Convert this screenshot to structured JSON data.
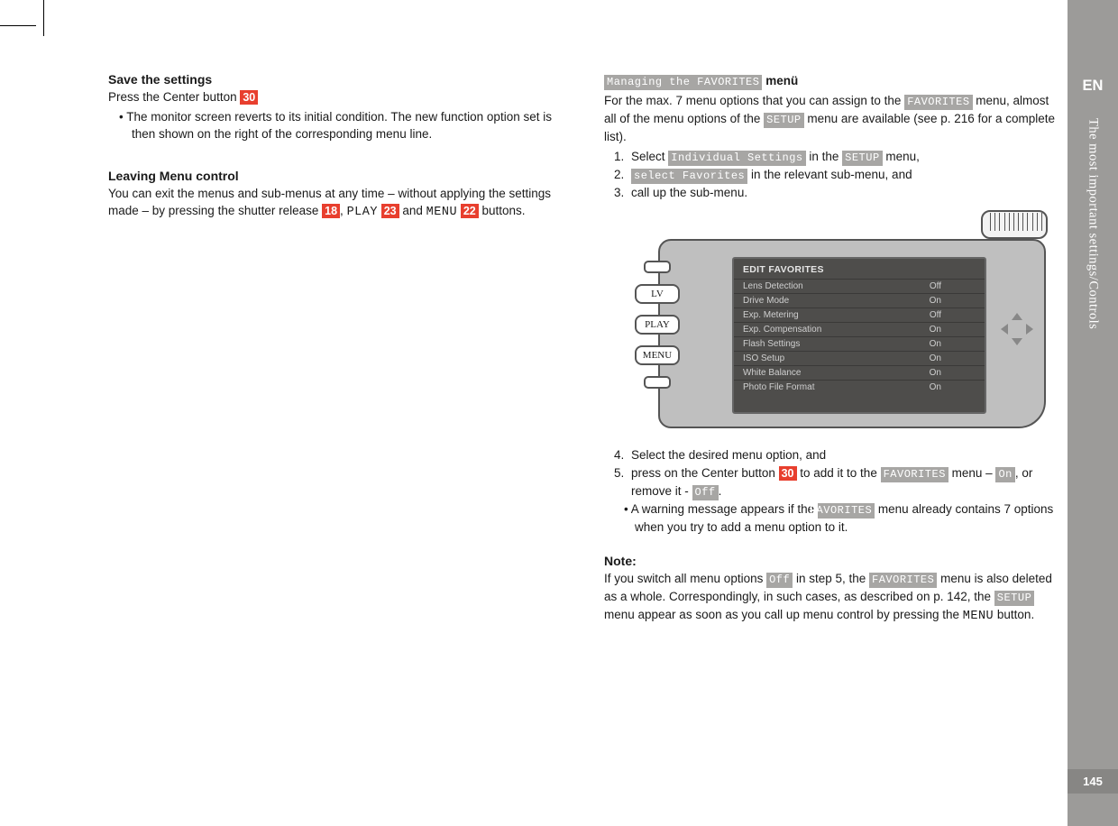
{
  "sidebar": {
    "language": "EN",
    "section_label": "The most important settings/Controls",
    "page_number": "145"
  },
  "left": {
    "save_heading": "Save the settings",
    "save_intro_a": "Press the Center button ",
    "save_intro_ref": "30",
    "save_bullet": "The monitor screen reverts to its initial condition. The new function option set is then shown on the right of the corresponding menu line.",
    "leave_heading": "Leaving Menu control",
    "leave_a": "You can exit the menus and sub-menus at any time – without applying the settings made – by pressing the shutter release ",
    "leave_ref1": "18",
    "leave_sep1": ", ",
    "leave_play": "PLAY",
    "leave_ref2": "23",
    "leave_b": " and ",
    "leave_menu": "MENU",
    "leave_ref3": "22",
    "leave_c": " buttons."
  },
  "right": {
    "managing_badge": "Managing the FAVORITES",
    "managing_tail": " menü",
    "intro_a": "For the max. 7 menu options that you can assign to the ",
    "intro_fav": "FAVORITES",
    "intro_b": " menu, almost all of the menu options of the ",
    "intro_setup": "SETUP",
    "intro_c": " menu are available (see p. 216 for a complete list).",
    "step1_a": "Select ",
    "step1_badge": "Individual Settings",
    "step1_b": " in the ",
    "step1_setup": "SETUP",
    "step1_c": " menu,",
    "step2_badge": "select Favorites",
    "step2_b": " in the relevant sub-menu, and",
    "step3": "call up the sub-menu.",
    "lcd_title": "EDIT FAVORITES",
    "lcd_rows": [
      {
        "label": "Lens Detection",
        "value": "Off"
      },
      {
        "label": "Drive Mode",
        "value": "On"
      },
      {
        "label": "Exp. Metering",
        "value": "Off"
      },
      {
        "label": "Exp. Compensation",
        "value": "On"
      },
      {
        "label": "Flash Settings",
        "value": "On"
      },
      {
        "label": "ISO Setup",
        "value": "On"
      },
      {
        "label": "White Balance",
        "value": "On"
      },
      {
        "label": "Photo File Format",
        "value": "On"
      }
    ],
    "side_buttons": {
      "lv": "LV",
      "play": "PLAY",
      "menu": "MENU"
    },
    "step4": "Select the desired menu option, and",
    "step5_a": "press on the Center button ",
    "step5_ref": "30",
    "step5_b": " to add it to the ",
    "step5_fav": "FAVORITES",
    "step5_c": " menu – ",
    "step5_on": "On",
    "step5_d": ", or remove it - ",
    "step5_off": "Off",
    "step5_e": ".",
    "step5_sub_a": "A warning message appears if the ",
    "step5_sub_fav": "FAVORITES",
    "step5_sub_b": " menu already contains 7 options when you try to add a menu option to it.",
    "note_heading": "Note:",
    "note_a": "If you switch all menu options ",
    "note_off": "Off",
    "note_b": " in step 5, the ",
    "note_fav": "FAVORITES",
    "note_c": " menu is also deleted as a whole. Correspondingly, in such cases, as described on p. 142, the ",
    "note_setup": "SETUP",
    "note_d": " menu appear as soon as you call up menu control by pressing the ",
    "note_menu": "MENU",
    "note_e": " button."
  }
}
